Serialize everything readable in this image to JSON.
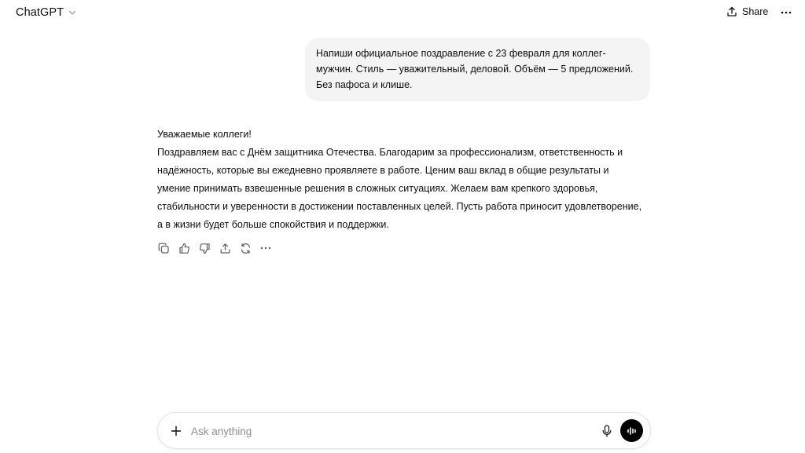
{
  "header": {
    "model_name": "ChatGPT",
    "share_label": "Share"
  },
  "conversation": {
    "user_message": "Напиши официальное поздравление с 23 февраля для коллег-мужчин. Стиль — уважительный, деловой. Объём — 5 предложений. Без пафоса и клише.",
    "assistant_greeting": "Уважаемые коллеги!",
    "assistant_body": "Поздравляем вас с Днём защитника Отечества. Благодарим за профессионализм, ответственность и надёжность, которые вы ежедневно проявляете в работе. Ценим ваш вклад в общие результаты и умение принимать взвешенные решения в сложных ситуациях. Желаем вам крепкого здоровья, стабильности и уверенности в достижении поставленных целей. Пусть работа приносит удовлетворение, а в жизни будет больше спокойствия и поддержки."
  },
  "message_actions": [
    "copy-icon",
    "thumbs-up-icon",
    "thumbs-down-icon",
    "share-icon",
    "regenerate-icon",
    "more-icon"
  ],
  "composer": {
    "placeholder": "Ask anything",
    "value": ""
  },
  "colors": {
    "user_bubble": "#f4f4f4",
    "voice_button": "#000000",
    "placeholder": "#8f8f8f",
    "text": "#0d0d0d"
  }
}
